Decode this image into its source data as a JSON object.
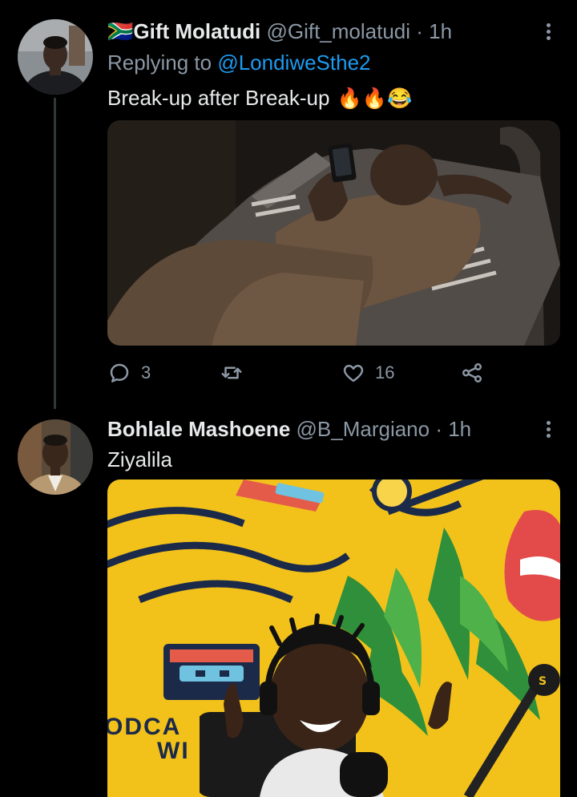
{
  "tweets": [
    {
      "flag": "🇿🇦",
      "name": "Gift Molatudi",
      "handle": "@Gift_molatudi",
      "time": "· 1h",
      "replying_label": "Replying to",
      "replying_to": "@LondiweSthe2",
      "text": "Break-up after Break-up",
      "emojis": "🔥🔥😂",
      "actions": {
        "replies": "3",
        "retweets": "",
        "likes": "16"
      }
    },
    {
      "name": "Bohlale Mashoene",
      "handle": "@B_Margiano",
      "time": "· 1h",
      "text": "Ziyalila",
      "media_text": {
        "line1": "ODCA",
        "line2": "WI"
      }
    }
  ],
  "icons": [
    "more-icon",
    "reply-icon",
    "retweet-icon",
    "like-icon",
    "share-icon"
  ],
  "colors": {
    "background": "#000000",
    "text": "#e7e9ea",
    "secondary": "#8b98a5",
    "link": "#1d9bf0",
    "media_yellow": "#f2c21b"
  }
}
